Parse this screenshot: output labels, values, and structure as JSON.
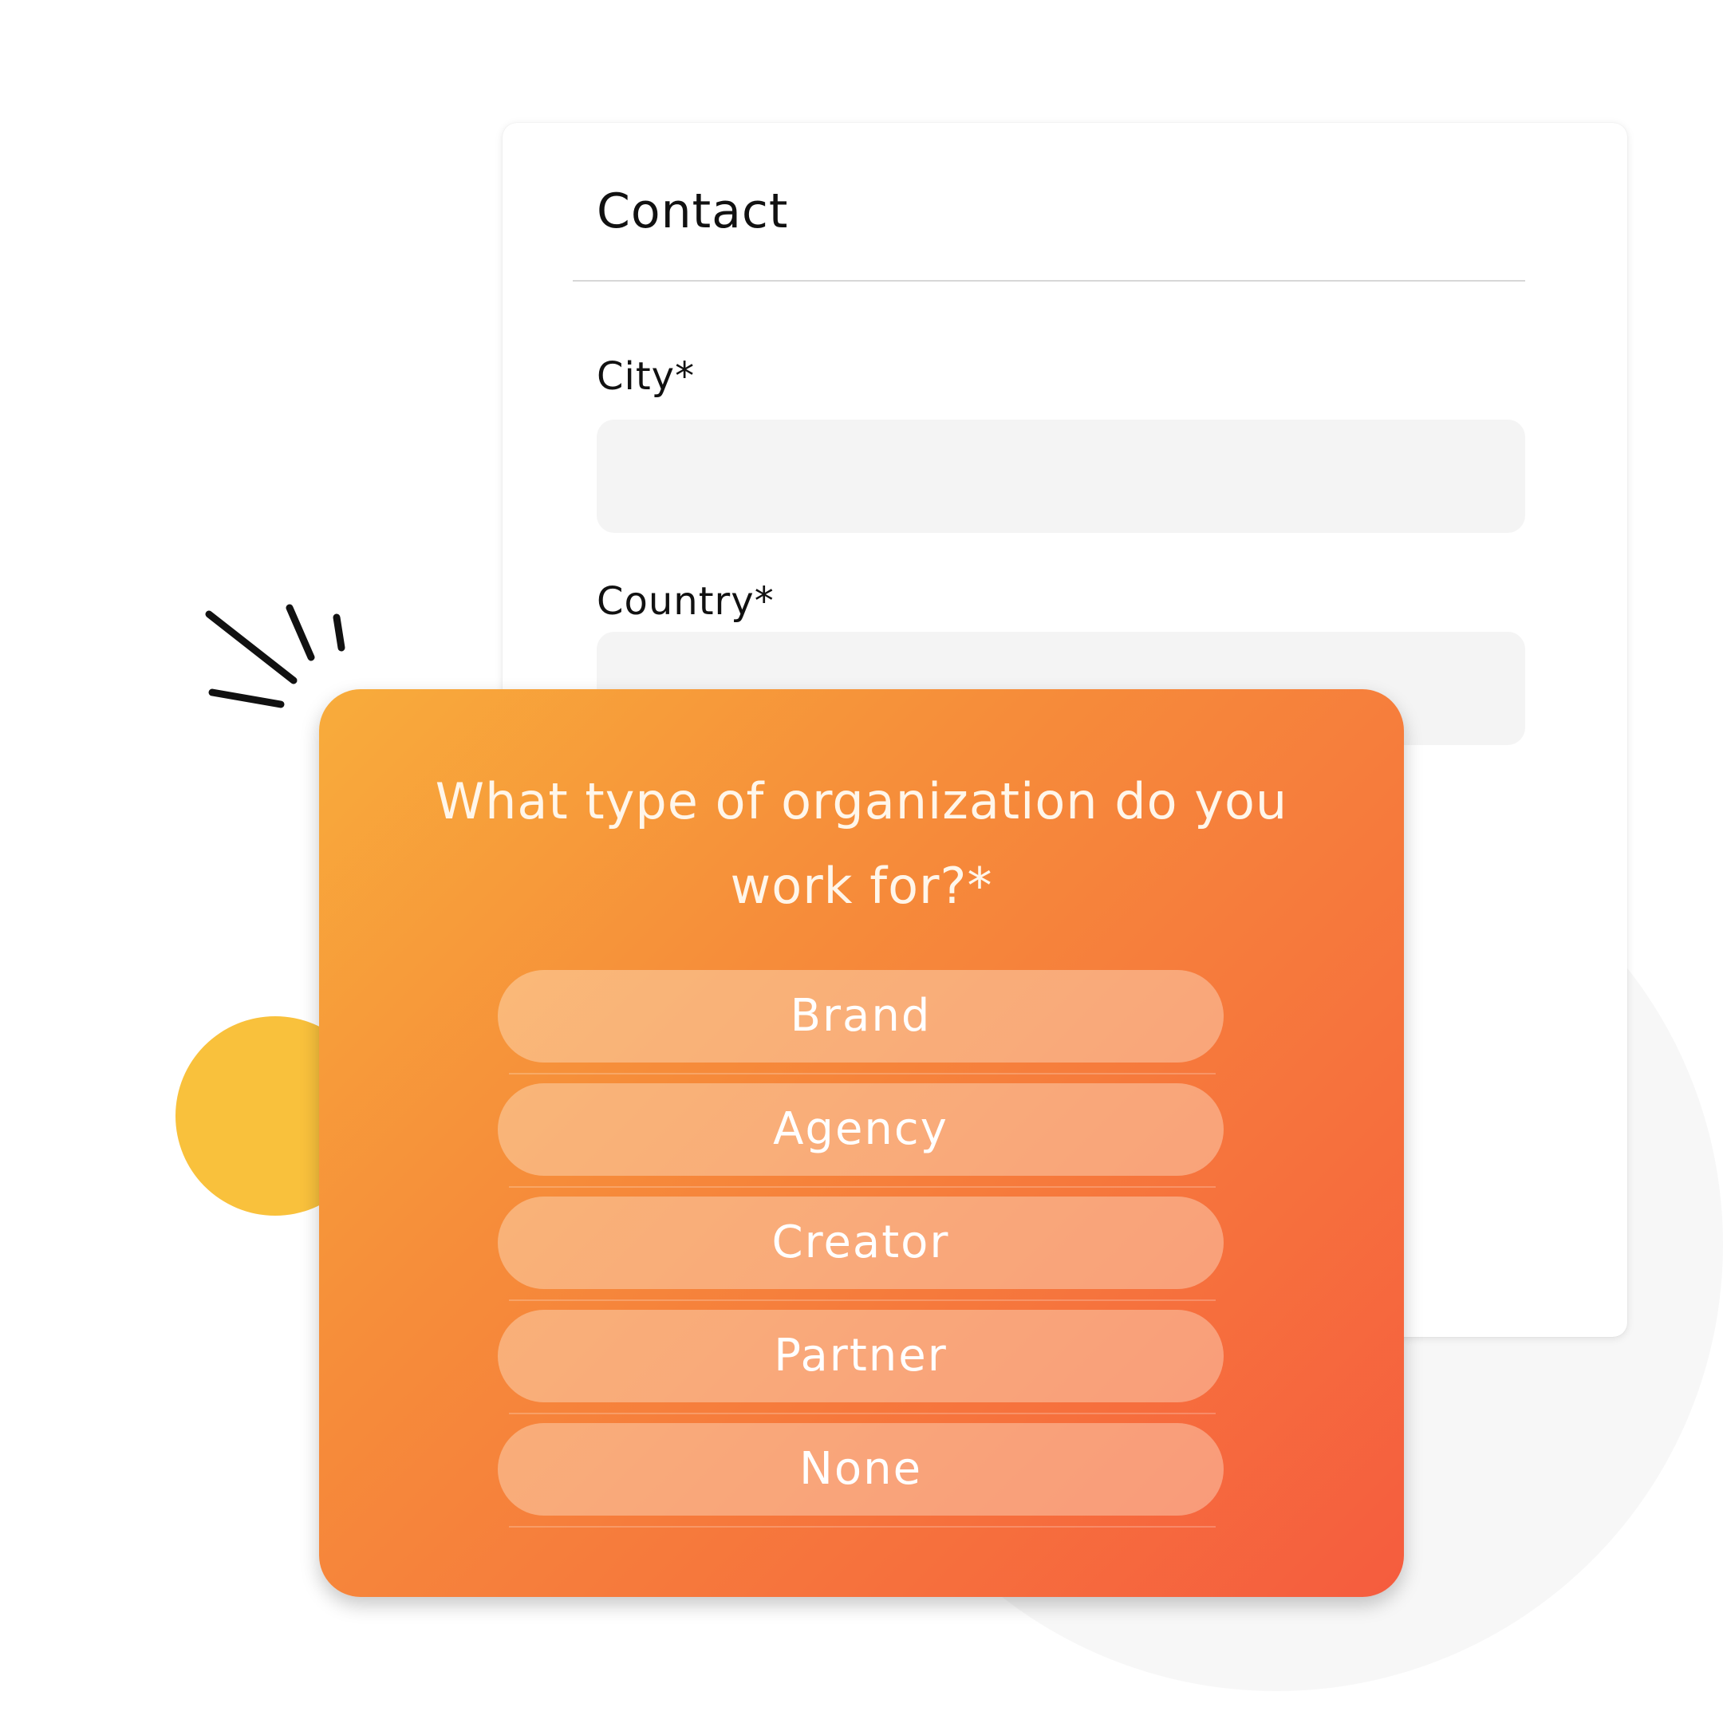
{
  "contact": {
    "title": "Contact",
    "fields": [
      {
        "label": "City*",
        "value": ""
      },
      {
        "label": "Country*",
        "value": ""
      }
    ]
  },
  "question": {
    "title": "What type of organization do you work for?*",
    "options": [
      "Brand",
      "Agency",
      "Creator",
      "Partner",
      "None"
    ]
  },
  "colors": {
    "gradient_start": "#f8ac3b",
    "gradient_end": "#f55c3e",
    "yellow_dot": "#f9c13c",
    "input_background": "#f4f4f4"
  }
}
